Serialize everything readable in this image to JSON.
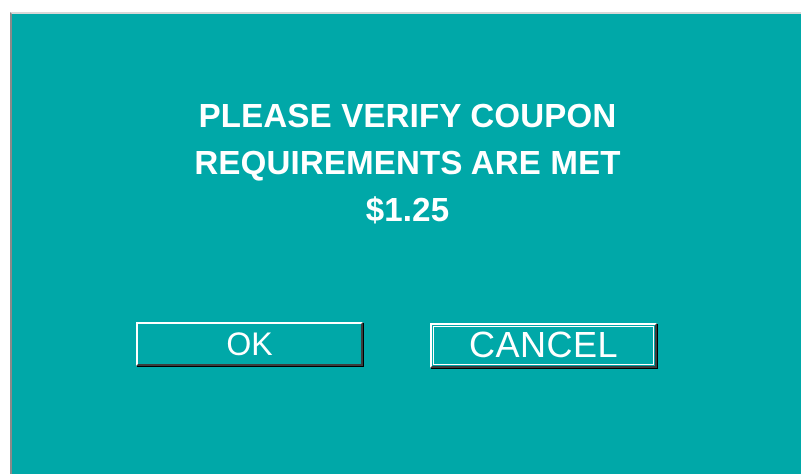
{
  "dialog": {
    "message_lines": [
      "PLEASE VERIFY COUPON",
      "REQUIREMENTS ARE MET",
      "$1.25"
    ],
    "buttons": {
      "ok_label": "OK",
      "cancel_label": "CANCEL"
    }
  },
  "colors": {
    "dialog_background": "#00a8a8",
    "text": "#ffffff"
  }
}
